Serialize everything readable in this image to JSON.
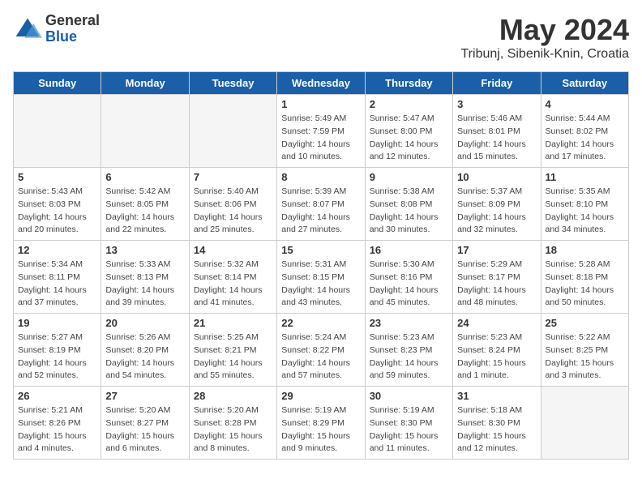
{
  "header": {
    "logo_general": "General",
    "logo_blue": "Blue",
    "title": "May 2024",
    "subtitle": "Tribunj, Sibenik-Knin, Croatia"
  },
  "weekdays": [
    "Sunday",
    "Monday",
    "Tuesday",
    "Wednesday",
    "Thursday",
    "Friday",
    "Saturday"
  ],
  "weeks": [
    [
      {
        "day": "",
        "info": ""
      },
      {
        "day": "",
        "info": ""
      },
      {
        "day": "",
        "info": ""
      },
      {
        "day": "1",
        "sunrise": "Sunrise: 5:49 AM",
        "sunset": "Sunset: 7:59 PM",
        "daylight": "Daylight: 14 hours and 10 minutes."
      },
      {
        "day": "2",
        "sunrise": "Sunrise: 5:47 AM",
        "sunset": "Sunset: 8:00 PM",
        "daylight": "Daylight: 14 hours and 12 minutes."
      },
      {
        "day": "3",
        "sunrise": "Sunrise: 5:46 AM",
        "sunset": "Sunset: 8:01 PM",
        "daylight": "Daylight: 14 hours and 15 minutes."
      },
      {
        "day": "4",
        "sunrise": "Sunrise: 5:44 AM",
        "sunset": "Sunset: 8:02 PM",
        "daylight": "Daylight: 14 hours and 17 minutes."
      }
    ],
    [
      {
        "day": "5",
        "sunrise": "Sunrise: 5:43 AM",
        "sunset": "Sunset: 8:03 PM",
        "daylight": "Daylight: 14 hours and 20 minutes."
      },
      {
        "day": "6",
        "sunrise": "Sunrise: 5:42 AM",
        "sunset": "Sunset: 8:05 PM",
        "daylight": "Daylight: 14 hours and 22 minutes."
      },
      {
        "day": "7",
        "sunrise": "Sunrise: 5:40 AM",
        "sunset": "Sunset: 8:06 PM",
        "daylight": "Daylight: 14 hours and 25 minutes."
      },
      {
        "day": "8",
        "sunrise": "Sunrise: 5:39 AM",
        "sunset": "Sunset: 8:07 PM",
        "daylight": "Daylight: 14 hours and 27 minutes."
      },
      {
        "day": "9",
        "sunrise": "Sunrise: 5:38 AM",
        "sunset": "Sunset: 8:08 PM",
        "daylight": "Daylight: 14 hours and 30 minutes."
      },
      {
        "day": "10",
        "sunrise": "Sunrise: 5:37 AM",
        "sunset": "Sunset: 8:09 PM",
        "daylight": "Daylight: 14 hours and 32 minutes."
      },
      {
        "day": "11",
        "sunrise": "Sunrise: 5:35 AM",
        "sunset": "Sunset: 8:10 PM",
        "daylight": "Daylight: 14 hours and 34 minutes."
      }
    ],
    [
      {
        "day": "12",
        "sunrise": "Sunrise: 5:34 AM",
        "sunset": "Sunset: 8:11 PM",
        "daylight": "Daylight: 14 hours and 37 minutes."
      },
      {
        "day": "13",
        "sunrise": "Sunrise: 5:33 AM",
        "sunset": "Sunset: 8:13 PM",
        "daylight": "Daylight: 14 hours and 39 minutes."
      },
      {
        "day": "14",
        "sunrise": "Sunrise: 5:32 AM",
        "sunset": "Sunset: 8:14 PM",
        "daylight": "Daylight: 14 hours and 41 minutes."
      },
      {
        "day": "15",
        "sunrise": "Sunrise: 5:31 AM",
        "sunset": "Sunset: 8:15 PM",
        "daylight": "Daylight: 14 hours and 43 minutes."
      },
      {
        "day": "16",
        "sunrise": "Sunrise: 5:30 AM",
        "sunset": "Sunset: 8:16 PM",
        "daylight": "Daylight: 14 hours and 45 minutes."
      },
      {
        "day": "17",
        "sunrise": "Sunrise: 5:29 AM",
        "sunset": "Sunset: 8:17 PM",
        "daylight": "Daylight: 14 hours and 48 minutes."
      },
      {
        "day": "18",
        "sunrise": "Sunrise: 5:28 AM",
        "sunset": "Sunset: 8:18 PM",
        "daylight": "Daylight: 14 hours and 50 minutes."
      }
    ],
    [
      {
        "day": "19",
        "sunrise": "Sunrise: 5:27 AM",
        "sunset": "Sunset: 8:19 PM",
        "daylight": "Daylight: 14 hours and 52 minutes."
      },
      {
        "day": "20",
        "sunrise": "Sunrise: 5:26 AM",
        "sunset": "Sunset: 8:20 PM",
        "daylight": "Daylight: 14 hours and 54 minutes."
      },
      {
        "day": "21",
        "sunrise": "Sunrise: 5:25 AM",
        "sunset": "Sunset: 8:21 PM",
        "daylight": "Daylight: 14 hours and 55 minutes."
      },
      {
        "day": "22",
        "sunrise": "Sunrise: 5:24 AM",
        "sunset": "Sunset: 8:22 PM",
        "daylight": "Daylight: 14 hours and 57 minutes."
      },
      {
        "day": "23",
        "sunrise": "Sunrise: 5:23 AM",
        "sunset": "Sunset: 8:23 PM",
        "daylight": "Daylight: 14 hours and 59 minutes."
      },
      {
        "day": "24",
        "sunrise": "Sunrise: 5:23 AM",
        "sunset": "Sunset: 8:24 PM",
        "daylight": "Daylight: 15 hours and 1 minute."
      },
      {
        "day": "25",
        "sunrise": "Sunrise: 5:22 AM",
        "sunset": "Sunset: 8:25 PM",
        "daylight": "Daylight: 15 hours and 3 minutes."
      }
    ],
    [
      {
        "day": "26",
        "sunrise": "Sunrise: 5:21 AM",
        "sunset": "Sunset: 8:26 PM",
        "daylight": "Daylight: 15 hours and 4 minutes."
      },
      {
        "day": "27",
        "sunrise": "Sunrise: 5:20 AM",
        "sunset": "Sunset: 8:27 PM",
        "daylight": "Daylight: 15 hours and 6 minutes."
      },
      {
        "day": "28",
        "sunrise": "Sunrise: 5:20 AM",
        "sunset": "Sunset: 8:28 PM",
        "daylight": "Daylight: 15 hours and 8 minutes."
      },
      {
        "day": "29",
        "sunrise": "Sunrise: 5:19 AM",
        "sunset": "Sunset: 8:29 PM",
        "daylight": "Daylight: 15 hours and 9 minutes."
      },
      {
        "day": "30",
        "sunrise": "Sunrise: 5:19 AM",
        "sunset": "Sunset: 8:30 PM",
        "daylight": "Daylight: 15 hours and 11 minutes."
      },
      {
        "day": "31",
        "sunrise": "Sunrise: 5:18 AM",
        "sunset": "Sunset: 8:30 PM",
        "daylight": "Daylight: 15 hours and 12 minutes."
      },
      {
        "day": "",
        "info": ""
      }
    ]
  ]
}
